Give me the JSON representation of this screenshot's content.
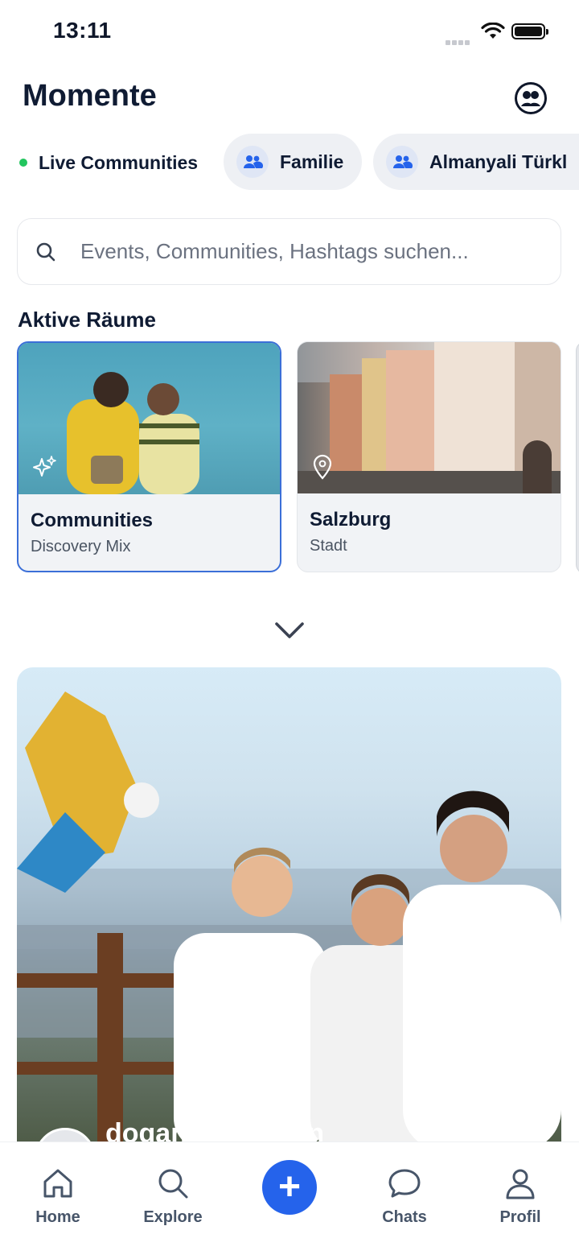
{
  "status_bar": {
    "time": "13:11"
  },
  "header": {
    "title": "Momente",
    "profile_icon": "user-circle-icon"
  },
  "chips": {
    "live_label": "Live Communities",
    "live_color": "#22c55e",
    "items": [
      {
        "label": "Familie",
        "icon": "group-icon"
      },
      {
        "label": "Almanyali Türkl",
        "icon": "group-icon"
      }
    ]
  },
  "search": {
    "placeholder": "Events, Communities, Hashtags suchen..."
  },
  "active_rooms": {
    "title": "Aktive Räume",
    "cards": [
      {
        "name": "Communities",
        "subtitle": "Discovery Mix",
        "icon": "sparkles-icon",
        "selected": true
      },
      {
        "name": "Salzburg",
        "subtitle": "Stadt",
        "icon": "location-pin-icon",
        "selected": false
      }
    ]
  },
  "feed": {
    "post_user": "dogankaraarslan"
  },
  "bottom_nav": {
    "home": "Home",
    "explore": "Explore",
    "chats": "Chats",
    "profil": "Profil",
    "create": "+"
  },
  "colors": {
    "accent": "#2563eb",
    "text_dark": "#0f1b33",
    "selected_border": "#3b6fd8"
  }
}
